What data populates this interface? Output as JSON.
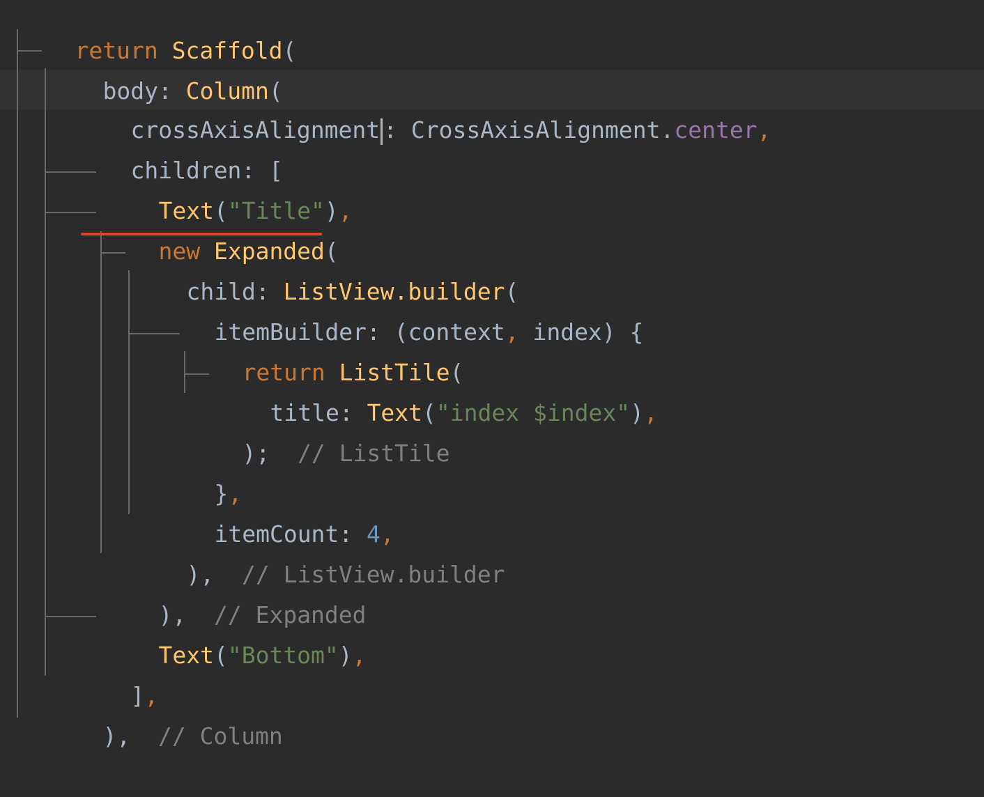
{
  "editor": {
    "lines": [
      {
        "t1": "return",
        "t2": "Scaffold",
        "t3": "("
      },
      {
        "t1": "body: ",
        "t2": "Column",
        "t3": "("
      },
      {
        "t1": "crossAxisAlignment",
        "t2": ": CrossAxisAlignment.",
        "t3": "center",
        "t4": ","
      },
      {
        "t1": "children: ["
      },
      {
        "t1": "Text",
        "t2": "(",
        "t3": "\"Title\"",
        "t4": ")",
        "t5": ","
      },
      {
        "t1": "new",
        "t2": "Expanded",
        "t3": "("
      },
      {
        "t1": "child: ",
        "t2": "ListView.builder",
        "t3": "("
      },
      {
        "t1": "itemBuilder: (context",
        "t2": ",",
        "t3": " index) {"
      },
      {
        "t1": "return",
        "t2": "ListTile",
        "t3": "("
      },
      {
        "t1": "title: ",
        "t2": "Text",
        "t3": "(",
        "t4": "\"index $index\"",
        "t5": ")",
        "t6": ","
      },
      {
        "t1": ");",
        "t2": "// ListTile"
      },
      {
        "t1": "}",
        "t2": ","
      },
      {
        "t1": "itemCount: ",
        "t2": "4",
        "t3": ","
      },
      {
        "t1": "),",
        "t2": "// ListView.builder"
      },
      {
        "t1": "),",
        "t2": "// Expanded"
      },
      {
        "t1": "Text",
        "t2": "(",
        "t3": "\"Bottom\"",
        "t4": ")",
        "t5": ","
      },
      {
        "t1": "]",
        "t2": ","
      },
      {
        "t1": "),",
        "t2": "// Column"
      }
    ]
  },
  "colors": {
    "background": "#2b2b2b",
    "keyword": "#cc7832",
    "class": "#ffc66d",
    "text": "#a9b7c6",
    "string": "#6a8759",
    "number": "#6897bb",
    "property": "#9876aa",
    "comment": "#808080",
    "underline": "#e0442a"
  }
}
